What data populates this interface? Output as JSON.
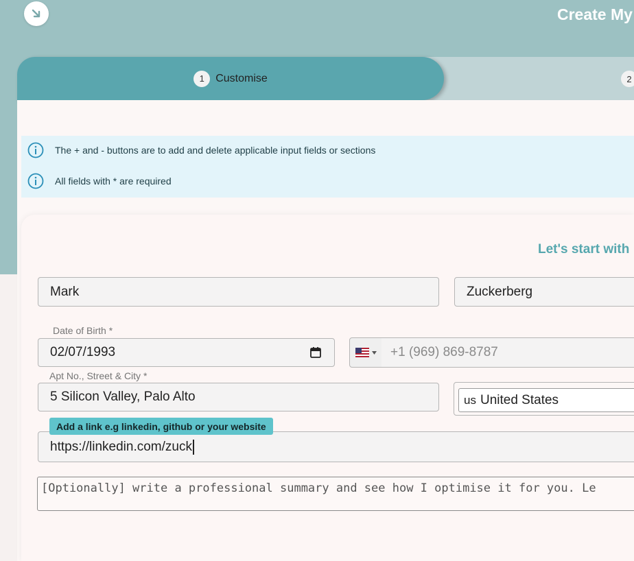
{
  "header": {
    "title": "Create My",
    "back_icon": "arrow-down-right-icon"
  },
  "steps": [
    {
      "number": "1",
      "label": "Customise"
    },
    {
      "number": "2"
    }
  ],
  "info": [
    {
      "icon": "info-icon",
      "text": "The + and - buttons are to add and delete applicable input fields or sections"
    },
    {
      "icon": "info-icon",
      "text": "All fields with * are required"
    }
  ],
  "form": {
    "heading": "Let's start with",
    "first_name": "Mark",
    "last_name": "Zuckerberg",
    "dob_label": "Date of Birth *",
    "dob_value": "02/07/1993",
    "phone_country_icon": "us-flag-icon",
    "phone_placeholder": "+1 (969) 869-8787",
    "address_label": "Apt No., Street & City *",
    "address_value": "5 Silicon Valley, Palo Alto",
    "country_code": "us",
    "country_name": "United States",
    "link_tooltip": "Add a link e.g linkedin, github or your website",
    "link_value": "https://linkedin.com/zuck",
    "summary_placeholder": "[Optionally] write a professional summary and see how I optimise it for you. Le"
  },
  "colors": {
    "accent": "#5aa6ae",
    "header_bg": "#9cc1c2",
    "info_bg": "#e3f4fa",
    "tooltip_bg": "#5fc3cb"
  }
}
